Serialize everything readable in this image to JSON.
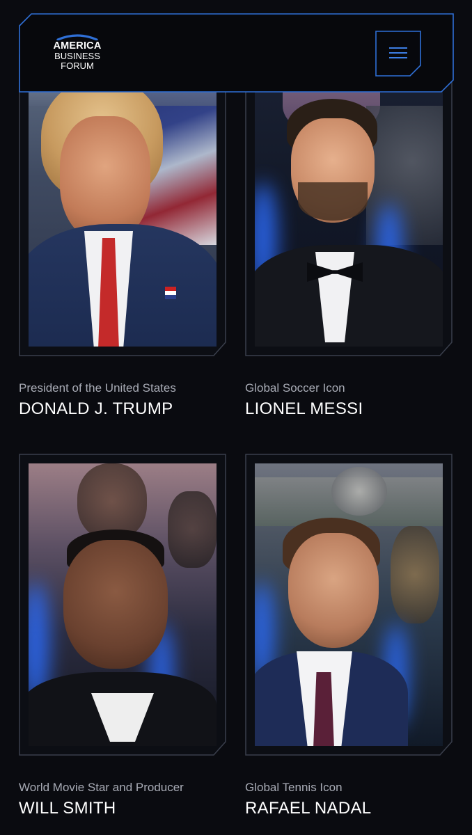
{
  "header": {
    "logo_line1": "AMERICA",
    "logo_line2": "BUSINESS",
    "logo_line3": "FORUM",
    "menu_icon": "hamburger-menu-icon",
    "accent_color": "#2f6fd6"
  },
  "speakers": [
    {
      "title": "President of the United States",
      "name": "DONALD J. TRUMP"
    },
    {
      "title": "Global Soccer Icon",
      "name": "LIONEL MESSI"
    },
    {
      "title": "World Movie Star and Producer",
      "name": "WILL SMITH"
    },
    {
      "title": "Global Tennis Icon",
      "name": "RAFAEL NADAL"
    }
  ]
}
